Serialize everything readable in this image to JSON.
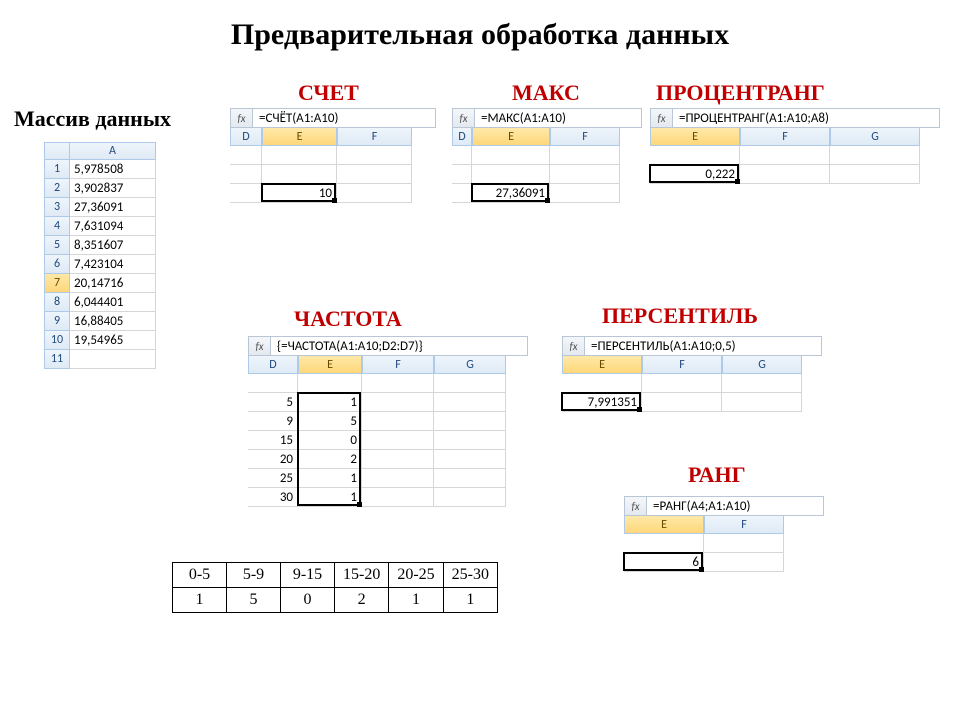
{
  "title": "Предварительная обработка данных",
  "labels": {
    "array": "Массив данных",
    "schet": "СЧЕТ",
    "maks": "МАКС",
    "procentrang": "ПРОЦЕНТРАНГ",
    "chastota": "ЧАСТОТА",
    "persentil": "ПЕРСЕНТИЛЬ",
    "rang": "РАНГ"
  },
  "data_array": {
    "col": "A",
    "rows": [
      "1",
      "2",
      "3",
      "4",
      "5",
      "6",
      "7",
      "8",
      "9",
      "10",
      "11"
    ],
    "active_row_index": 6,
    "values": [
      "5,978508",
      "3,902837",
      "27,36091",
      "7,631094",
      "8,351607",
      "7,423104",
      "20,14716",
      "6,044401",
      "16,88405",
      "19,54965",
      ""
    ]
  },
  "fx_label": "fx",
  "schet": {
    "formula": "=СЧЁТ(A1:A10)",
    "cols": [
      "D",
      "E",
      "F"
    ],
    "active_col_index": 1,
    "widths": [
      32,
      75,
      75
    ],
    "result": "10",
    "result_row": 2,
    "result_col": 1
  },
  "maks": {
    "formula": "=МАКС(A1:A10)",
    "cols": [
      "D",
      "E",
      "F"
    ],
    "active_col_index": 1,
    "widths": [
      20,
      78,
      70
    ],
    "result": "27,36091",
    "result_row": 2,
    "result_col": 1
  },
  "procentrang": {
    "formula": "=ПРОЦЕНТРАНГ(A1:A10;A8)",
    "cols": [
      "E",
      "F",
      "G"
    ],
    "active_col_index": 0,
    "widths": [
      90,
      90,
      90
    ],
    "result": "0,222",
    "result_row": 1,
    "result_col": 0
  },
  "chastota": {
    "formula": "{=ЧАСТОТА(A1:A10;D2:D7)}",
    "cols": [
      "D",
      "E",
      "F",
      "G"
    ],
    "active_col_index": 1,
    "widths": [
      50,
      64,
      72,
      72
    ],
    "bins": [
      "5",
      "9",
      "15",
      "20",
      "25",
      "30"
    ],
    "counts": [
      "1",
      "5",
      "0",
      "2",
      "1",
      "1"
    ]
  },
  "persentil": {
    "formula": "=ПЕРСЕНТИЛЬ(A1:A10;0,5)",
    "cols": [
      "E",
      "F",
      "G"
    ],
    "active_col_index": 0,
    "widths": [
      80,
      80,
      80
    ],
    "result": "7,991351",
    "result_row": 1,
    "result_col": 0
  },
  "rang": {
    "formula": "=РАНГ(A4;A1:A10)",
    "cols": [
      "E",
      "F"
    ],
    "active_col_index": 0,
    "widths": [
      80,
      80
    ],
    "result": "6",
    "result_row": 1,
    "result_col": 0
  },
  "summary": {
    "headers": [
      "0-5",
      "5-9",
      "9-15",
      "15-20",
      "20-25",
      "25-30"
    ],
    "values": [
      "1",
      "5",
      "0",
      "2",
      "1",
      "1"
    ]
  }
}
